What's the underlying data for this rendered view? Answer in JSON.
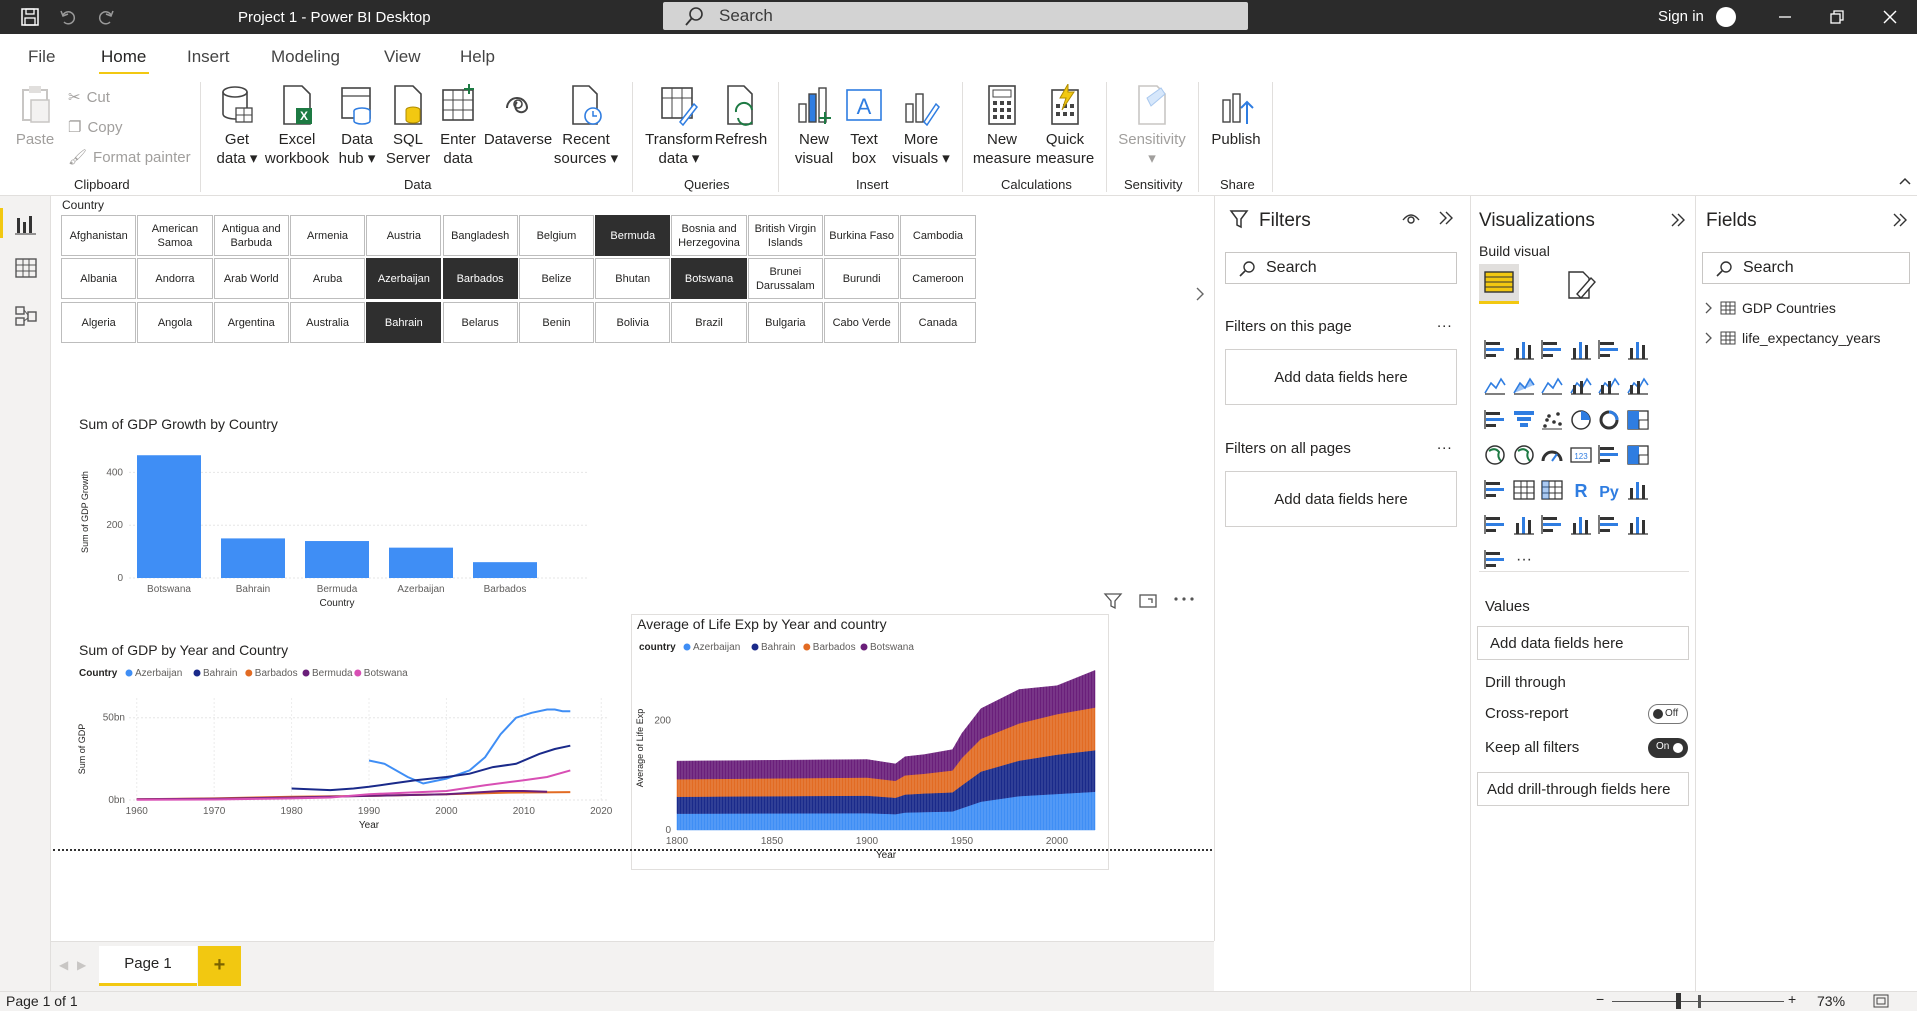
{
  "window": {
    "title": "Project 1 - Power BI Desktop",
    "search_placeholder": "Search",
    "sign_in": "Sign in"
  },
  "menu": {
    "items": [
      "File",
      "Home",
      "Insert",
      "Modeling",
      "View",
      "Help"
    ],
    "active": "Home"
  },
  "ribbon": {
    "clipboard": {
      "paste": "Paste",
      "cut": "Cut",
      "copy": "Copy",
      "format_painter": "Format painter",
      "label": "Clipboard"
    },
    "data": {
      "label": "Data",
      "buttons": [
        {
          "line1": "Get",
          "line2": "data ▾"
        },
        {
          "line1": "Excel",
          "line2": "workbook"
        },
        {
          "line1": "Data",
          "line2": "hub ▾"
        },
        {
          "line1": "SQL",
          "line2": "Server"
        },
        {
          "line1": "Enter",
          "line2": "data"
        },
        {
          "line1": "Dataverse",
          "line2": ""
        },
        {
          "line1": "Recent",
          "line2": "sources ▾"
        }
      ]
    },
    "queries": {
      "label": "Queries",
      "transform": {
        "line1": "Transform",
        "line2": "data ▾"
      },
      "refresh": "Refresh"
    },
    "insert": {
      "label": "Insert",
      "new_visual": {
        "line1": "New",
        "line2": "visual"
      },
      "text_box": {
        "line1": "Text",
        "line2": "box"
      },
      "more_visuals": {
        "line1": "More",
        "line2": "visuals ▾"
      }
    },
    "calculations": {
      "label": "Calculations",
      "new_measure": {
        "line1": "New",
        "line2": "measure"
      },
      "quick_measure": {
        "line1": "Quick",
        "line2": "measure"
      }
    },
    "sensitivity": {
      "label": "Sensitivity",
      "button": {
        "line1": "Sensitivity",
        "line2": "▾"
      }
    },
    "share": {
      "label": "Share",
      "publish": "Publish"
    }
  },
  "slicer": {
    "title": "Country",
    "rows": [
      [
        "Afghanistan",
        "American Samoa",
        "Antigua and Barbuda",
        "Armenia",
        "Austria",
        "Bangladesh",
        "Belgium",
        "Bermuda",
        "Bosnia and Herzegovina",
        "British Virgin Islands",
        "Burkina Faso",
        "Cambodia"
      ],
      [
        "Albania",
        "Andorra",
        "Arab World",
        "Aruba",
        "Azerbaijan",
        "Barbados",
        "Belize",
        "Bhutan",
        "Botswana",
        "Brunei Darussalam",
        "Burundi",
        "Cameroon"
      ],
      [
        "Algeria",
        "Angola",
        "Argentina",
        "Australia",
        "Bahrain",
        "Belarus",
        "Benin",
        "Bolivia",
        "Brazil",
        "Bulgaria",
        "Cabo Verde",
        "Canada"
      ]
    ],
    "selected": [
      "Bermuda",
      "Azerbaijan",
      "Barbados",
      "Botswana",
      "Bahrain"
    ]
  },
  "chart_data": [
    {
      "type": "bar",
      "title": "Sum of GDP Growth by Country",
      "xlabel": "Country",
      "ylabel": "Sum of GDP Growth",
      "categories": [
        "Botswana",
        "Bahrain",
        "Bermuda",
        "Azerbaijan",
        "Barbados"
      ],
      "values": [
        465,
        150,
        140,
        115,
        60
      ],
      "yticks": [
        0,
        200,
        400
      ],
      "ylim": [
        0,
        500
      ],
      "color": "#3f8ef5"
    },
    {
      "type": "line",
      "title": "Sum of GDP by Year and Country",
      "legend_title": "Country",
      "xlabel": "Year",
      "ylabel": "Sum of GDP",
      "xticks": [
        1960,
        1970,
        1980,
        1990,
        2000,
        2010,
        2020
      ],
      "yticks": [
        {
          "v": 0,
          "label": "0bn"
        },
        {
          "v": 50,
          "label": "50bn"
        }
      ],
      "xlim": [
        1959,
        2021
      ],
      "ylim": [
        0,
        62
      ],
      "series": [
        {
          "name": "Azerbaijan",
          "color": "#3f8ef5",
          "points": [
            [
              1990,
              24
            ],
            [
              1992,
              22
            ],
            [
              1995,
              14
            ],
            [
              1997,
              10
            ],
            [
              2000,
              13
            ],
            [
              2003,
              18
            ],
            [
              2005,
              26
            ],
            [
              2007,
              40
            ],
            [
              2009,
              50
            ],
            [
              2011,
              53
            ],
            [
              2013,
              55
            ],
            [
              2014,
              55
            ],
            [
              2015,
              54
            ],
            [
              2016,
              54
            ]
          ]
        },
        {
          "name": "Bahrain",
          "color": "#1a2a8a",
          "points": [
            [
              1980,
              7
            ],
            [
              1985,
              6
            ],
            [
              1988,
              7
            ],
            [
              1990,
              8
            ],
            [
              1993,
              10
            ],
            [
              1996,
              12
            ],
            [
              2000,
              14
            ],
            [
              2003,
              16
            ],
            [
              2006,
              20
            ],
            [
              2009,
              22
            ],
            [
              2012,
              28
            ],
            [
              2014,
              31
            ],
            [
              2016,
              33
            ]
          ]
        },
        {
          "name": "Barbados",
          "color": "#e26b23",
          "points": [
            [
              1960,
              0.5
            ],
            [
              1970,
              1
            ],
            [
              1980,
              2
            ],
            [
              1990,
              2.5
            ],
            [
              2000,
              3.5
            ],
            [
              2008,
              4.5
            ],
            [
              2016,
              4.8
            ]
          ]
        },
        {
          "name": "Bermuda",
          "color": "#6a1f7a",
          "points": [
            [
              1960,
              0.4
            ],
            [
              1970,
              0.8
            ],
            [
              1980,
              1.5
            ],
            [
              1990,
              2.5
            ],
            [
              2000,
              3.5
            ],
            [
              2007,
              5.5
            ],
            [
              2010,
              5.5
            ],
            [
              2013,
              5
            ]
          ]
        },
        {
          "name": "Botswana",
          "color": "#d84fb4",
          "points": [
            [
              1960,
              0.1
            ],
            [
              1970,
              0.3
            ],
            [
              1980,
              1
            ],
            [
              1985,
              1.5
            ],
            [
              1990,
              3.5
            ],
            [
              1995,
              4.5
            ],
            [
              2000,
              5.5
            ],
            [
              2005,
              9
            ],
            [
              2010,
              12
            ],
            [
              2013,
              14
            ],
            [
              2016,
              18
            ]
          ]
        }
      ]
    },
    {
      "type": "area",
      "stacked": true,
      "title": "Average of Life Exp by Year and country",
      "legend_title": "country",
      "xlabel": "Year",
      "ylabel": "Average of Life Exp",
      "xticks": [
        1800,
        1850,
        1900,
        1950,
        2000
      ],
      "yticks": [
        0,
        200
      ],
      "xlim": [
        1800,
        2020
      ],
      "ylim": [
        0,
        300
      ],
      "years": [
        1800,
        1900,
        1915,
        1920,
        1930,
        1945,
        1950,
        1960,
        1980,
        2000,
        2020
      ],
      "series": [
        {
          "name": "Azerbaijan",
          "color": "#3f8ef5",
          "values": [
            30,
            31,
            29,
            32,
            33,
            34,
            40,
            52,
            62,
            66,
            70
          ]
        },
        {
          "name": "Bahrain",
          "color": "#1a2a8a",
          "values": [
            31,
            32,
            30,
            33,
            34,
            35,
            42,
            55,
            65,
            72,
            76
          ]
        },
        {
          "name": "Barbados",
          "color": "#e26b23",
          "values": [
            32,
            33,
            31,
            35,
            36,
            40,
            50,
            60,
            68,
            74,
            78
          ]
        },
        {
          "name": "Botswana",
          "color": "#6a1f7a",
          "values": [
            33,
            33,
            31,
            34,
            35,
            38,
            45,
            55,
            62,
            52,
            68
          ]
        }
      ]
    }
  ],
  "page_tabs": {
    "tabs": [
      "Page 1"
    ],
    "add": "+"
  },
  "filters": {
    "title": "Filters",
    "search": "Search",
    "on_this_page": "Filters on this page",
    "on_all_pages": "Filters on all pages",
    "add_fields": "Add data fields here",
    "ellipsis": "..."
  },
  "visualizations": {
    "title": "Visualizations",
    "build_visual": "Build visual",
    "values_label": "Values",
    "add_fields": "Add data fields here",
    "drill_through": "Drill through",
    "cross_report": "Cross-report",
    "cross_report_state": "Off",
    "keep_all_filters": "Keep all filters",
    "keep_all_filters_state": "On",
    "add_drill": "Add drill-through fields here",
    "more": "···",
    "r_label": "R",
    "py_label": "Py"
  },
  "fields": {
    "title": "Fields",
    "search": "Search",
    "tables": [
      "GDP Countries",
      "life_expectancy_years"
    ]
  },
  "status": {
    "page": "Page 1 of 1",
    "zoom": "73%",
    "minus": "−",
    "plus": "+"
  }
}
